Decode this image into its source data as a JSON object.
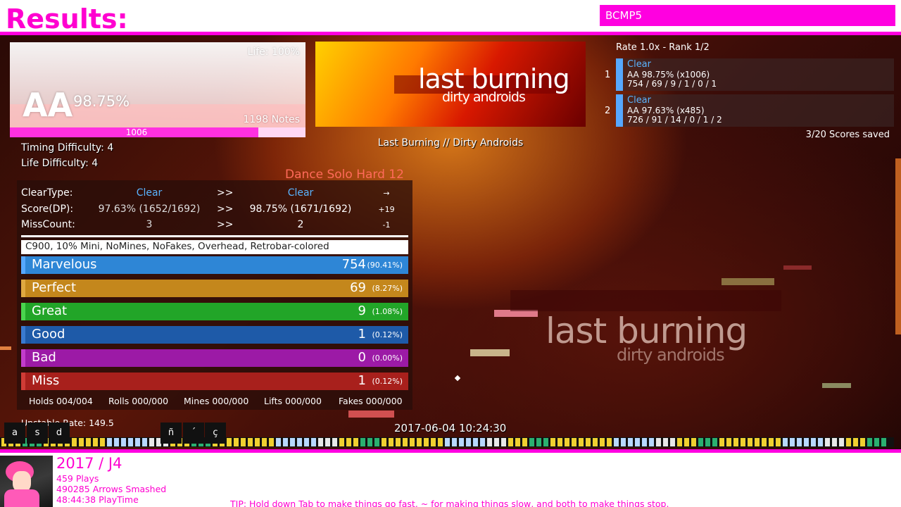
{
  "header": {
    "title": "Results:",
    "profile_name": "BCMP5"
  },
  "grade": {
    "life": "Life: 100%",
    "letter": "AA",
    "percent": "98.75%",
    "notes": "1198 Notes",
    "max_combo": "1006",
    "combo_fraction": 0.84
  },
  "difficulty_info": {
    "timing": "Timing Difficulty: 4",
    "life": "Life Difficulty: 4"
  },
  "song": {
    "banner_title": "last burning",
    "banner_subtitle": "dirty androids",
    "title": "Last Burning // Dirty Androids",
    "difficulty": "Dance Solo Hard 12"
  },
  "scoreboard": {
    "rate_rank": "Rate 1.0x - Rank 1/2",
    "entries": [
      {
        "rank": "1",
        "clear": "Clear",
        "grade": "AA 98.75% (x1006)",
        "judgments": "754 / 69 / 9 / 1 / 0 / 1"
      },
      {
        "rank": "2",
        "clear": "Clear",
        "grade": "AA 97.63% (x485)",
        "judgments": "726 / 91 / 14 / 0 / 1 / 2"
      }
    ],
    "saved": "3/20 Scores saved"
  },
  "compare": {
    "rows": [
      {
        "label": "ClearType:",
        "old": "Clear",
        "arrow": ">>",
        "new": "Clear",
        "delta": "→"
      },
      {
        "label": "Score(DP):",
        "old": "97.63% (1652/1692)",
        "arrow": ">>",
        "new": "98.75% (1671/1692)",
        "delta": "+19"
      },
      {
        "label": "MissCount:",
        "old": "3",
        "arrow": ">>",
        "new": "2",
        "delta": "-1"
      }
    ],
    "modifiers": "C900, 10% Mini, NoMines, NoFakes, Overhead, Retrobar-colored"
  },
  "judgments": [
    {
      "name": "Marvelous",
      "count": "754",
      "pct": "(90.41%)",
      "color": "#2e86d6",
      "edge": "#56a8ff",
      "fraction": 0.9041
    },
    {
      "name": "Perfect",
      "count": "69",
      "pct": "(8.27%)",
      "color": "#c4871c",
      "edge": "#e0a840",
      "fraction": 0.0827
    },
    {
      "name": "Great",
      "count": "9",
      "pct": "(1.08%)",
      "color": "#22a528",
      "edge": "#4ad44e",
      "fraction": 0.0108
    },
    {
      "name": "Good",
      "count": "1",
      "pct": "(0.12%)",
      "color": "#1e5aa8",
      "edge": "#3a7ad0",
      "fraction": 0.0012
    },
    {
      "name": "Bad",
      "count": "0",
      "pct": "(0.00%)",
      "color": "#9c1aa6",
      "edge": "#c23ccc",
      "fraction": 0.0
    },
    {
      "name": "Miss",
      "count": "1",
      "pct": "(0.12%)",
      "color": "#a8201c",
      "edge": "#d03c36",
      "fraction": 0.0012
    }
  ],
  "holds": {
    "holds": "Holds 004/004",
    "rolls": "Rolls 000/000",
    "mines": "Mines 000/000",
    "lifts": "Lifts 000/000",
    "fakes": "Fakes 000/000"
  },
  "unstable_rate": "Unstable Rate: 149.5",
  "datetime": "2017-06-04 10:24:30",
  "keys": [
    "a",
    "s",
    "d",
    "ñ",
    "´",
    "ç"
  ],
  "footer": {
    "year_title": "2017 / J4",
    "plays": "459 Plays",
    "arrows": "490285 Arrows Smashed",
    "playtime": "48:44:38 PlayTime",
    "tip": "TIP: Hold down Tab to make things go fast, ~ for making things slow, and both to make things stop."
  },
  "colors": {
    "accent": "#ff00e0",
    "clear_blue": "#5ab4ff",
    "difficulty": "#ff6a5a"
  }
}
